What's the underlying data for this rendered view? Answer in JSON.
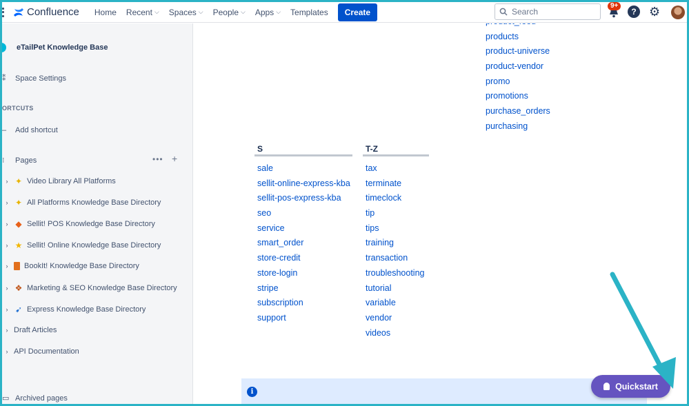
{
  "topnav": {
    "logo_text": "Confluence",
    "items": [
      {
        "label": "Home",
        "dropdown": false
      },
      {
        "label": "Recent",
        "dropdown": true
      },
      {
        "label": "Spaces",
        "dropdown": true
      },
      {
        "label": "People",
        "dropdown": true
      },
      {
        "label": "Apps",
        "dropdown": true
      },
      {
        "label": "Templates",
        "dropdown": false
      }
    ],
    "create_label": "Create",
    "search_placeholder": "Search",
    "notification_badge": "9+",
    "help_glyph": "?",
    "icons": [
      "app-switcher-icon",
      "confluence-logo-icon",
      "search-icon",
      "bell-icon",
      "help-icon",
      "gear-icon",
      "avatar"
    ]
  },
  "sidebar": {
    "space_title": "eTailPet Knowledge Base",
    "space_settings": "Space Settings",
    "shortcuts_header": "ORTCUTS",
    "add_shortcut": "Add shortcut",
    "pages_label": "Pages",
    "pages": [
      {
        "label": "Video Library All Platforms",
        "icon": "star-sparkle-icon"
      },
      {
        "label": "All Platforms Knowledge Base Directory",
        "icon": "star-sparkle-icon"
      },
      {
        "label": "Sellit! POS Knowledge Base Directory",
        "icon": "orange-diamond-icon"
      },
      {
        "label": "Sellit! Online Knowledge Base Directory",
        "icon": "star-icon"
      },
      {
        "label": "BookIt! Knowledge Base Directory",
        "icon": "book-icon"
      },
      {
        "label": "Marketing & SEO Knowledge Base Directory",
        "icon": "shapes-icon"
      },
      {
        "label": "Express Knowledge Base Directory",
        "icon": "rocket-icon"
      },
      {
        "label": "Draft Articles",
        "icon": ""
      },
      {
        "label": "API Documentation",
        "icon": ""
      }
    ],
    "archived_pages": "Archived pages"
  },
  "content": {
    "p_column_links": [
      "product_feed",
      "products",
      "product-universe",
      "product-vendor",
      "promo",
      "promotions",
      "purchase_orders",
      "purchasing"
    ],
    "s_column": {
      "header": "S",
      "links": [
        "sale",
        "sellit-online-express-kba",
        "sellit-pos-express-kba",
        "seo",
        "service",
        "smart_order",
        "store-credit",
        "store-login",
        "stripe",
        "subscription",
        "support"
      ]
    },
    "tz_column": {
      "header": "T-Z",
      "links": [
        "tax",
        "terminate",
        "timeclock",
        "tip",
        "tips",
        "training",
        "transaction",
        "troubleshooting",
        "tutorial",
        "variable",
        "vendor",
        "videos"
      ]
    },
    "info_icon": "i"
  },
  "quickstart": {
    "label": "Quickstart"
  },
  "colors": {
    "accent_blue": "#0052cc",
    "quickstart_purple": "#6554c0",
    "annotation_arrow": "#2bb3c6",
    "badge_red": "#de350b"
  }
}
